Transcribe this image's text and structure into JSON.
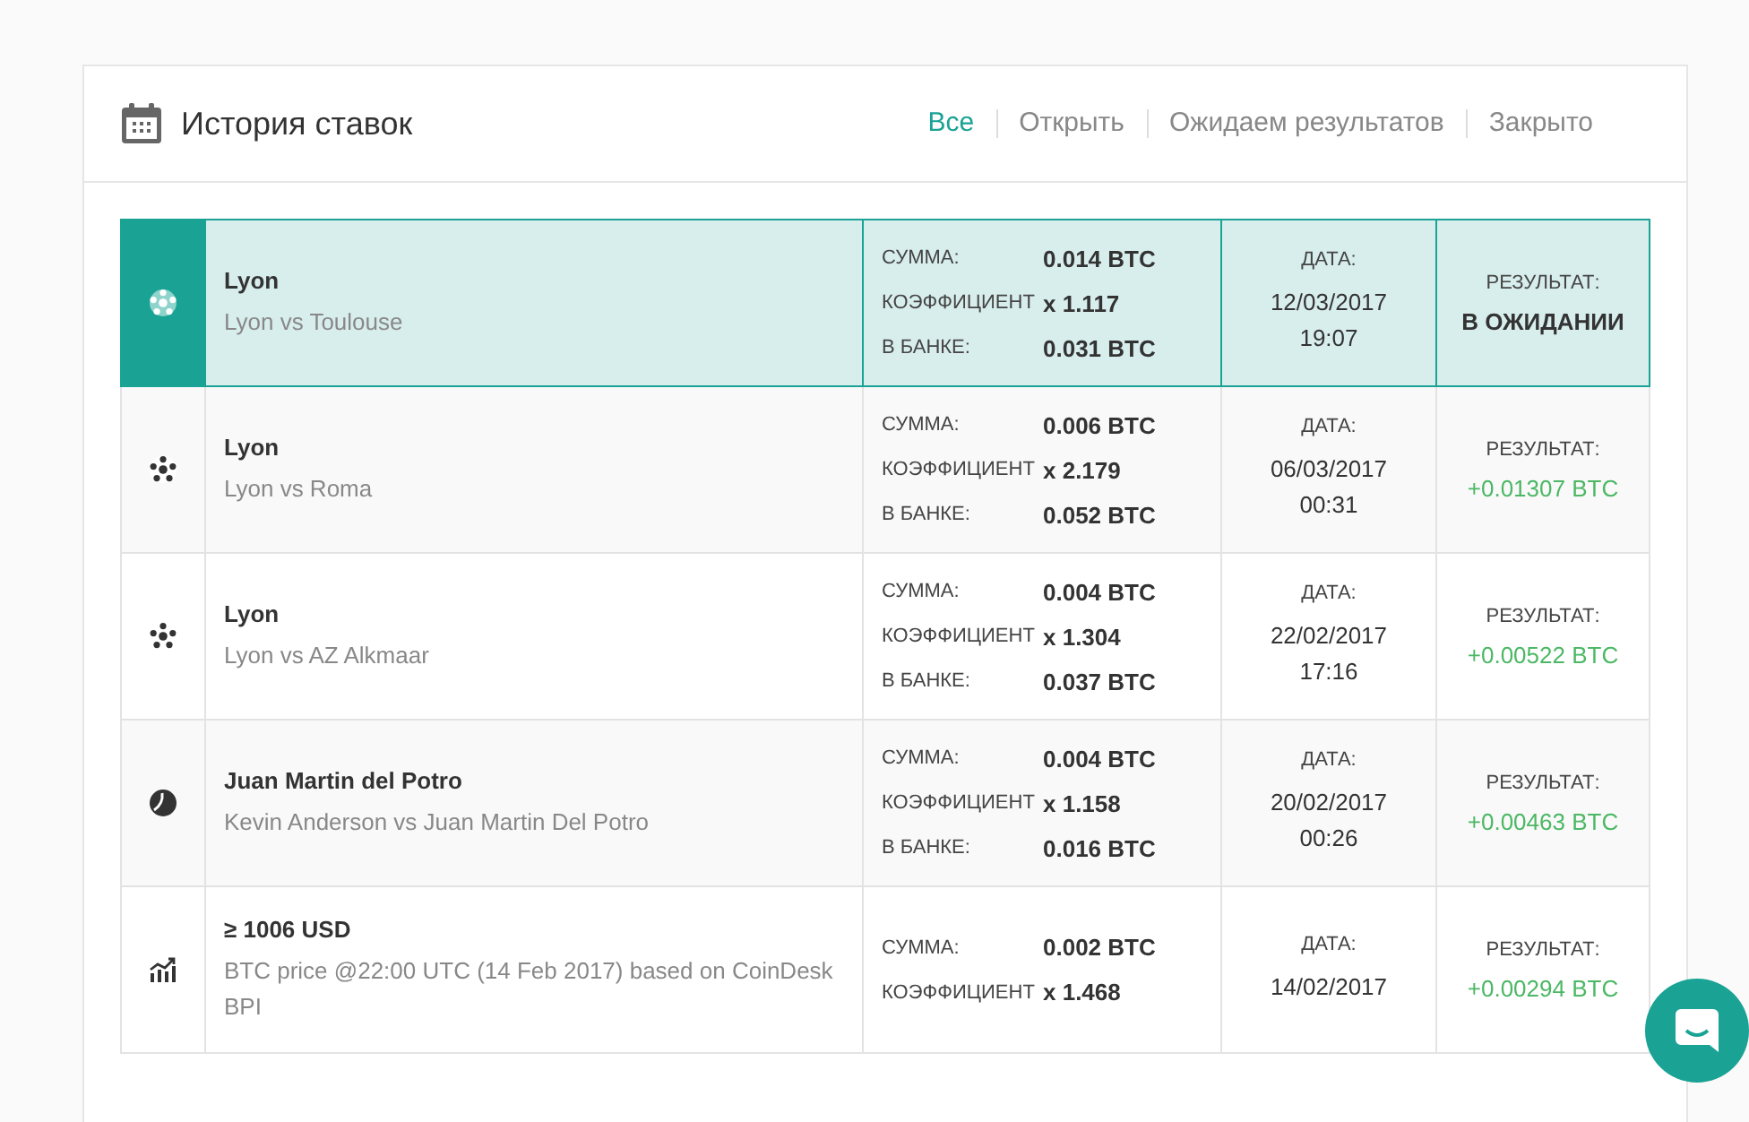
{
  "header": {
    "title": "История ставок"
  },
  "filters": [
    {
      "label": "Все",
      "selected": true
    },
    {
      "label": "Открыть",
      "selected": false
    },
    {
      "label": "Ожидаем результатов",
      "selected": false
    },
    {
      "label": "Закрыто",
      "selected": false
    }
  ],
  "rows": [
    {
      "selected": true,
      "kind": "soccer",
      "title": "Lyon",
      "subtitle": "Lyon vs Toulouse",
      "stake": [
        {
          "label": "СУММА:",
          "value": "0.014 BTC"
        },
        {
          "label": "КОЭФФИЦИЕНТ",
          "value": "x 1.117"
        },
        {
          "label": "В БАНКЕ:",
          "value": "0.031 BTC"
        }
      ],
      "date_label": "ДАТА:",
      "date": "12/03/2017",
      "time": "19:07",
      "result_label": "РЕЗУЛЬТАТ:",
      "result": {
        "kind": "pending",
        "text": "В ОЖИДАНИИ"
      }
    },
    {
      "selected": false,
      "kind": "soccer",
      "title": "Lyon",
      "subtitle": "Lyon vs Roma",
      "stake": [
        {
          "label": "СУММА:",
          "value": "0.006 BTC"
        },
        {
          "label": "КОЭФФИЦИЕНТ",
          "value": "x 2.179"
        },
        {
          "label": "В БАНКЕ:",
          "value": "0.052 BTC"
        }
      ],
      "date_label": "ДАТА:",
      "date": "06/03/2017",
      "time": "00:31",
      "result_label": "РЕЗУЛЬТАТ:",
      "result": {
        "kind": "win",
        "text": "+0.01307 BTC"
      }
    },
    {
      "selected": false,
      "kind": "soccer",
      "title": "Lyon",
      "subtitle": "Lyon vs AZ Alkmaar",
      "stake": [
        {
          "label": "СУММА:",
          "value": "0.004 BTC"
        },
        {
          "label": "КОЭФФИЦИЕНТ",
          "value": "x 1.304"
        },
        {
          "label": "В БАНКЕ:",
          "value": "0.037 BTC"
        }
      ],
      "date_label": "ДАТА:",
      "date": "22/02/2017",
      "time": "17:16",
      "result_label": "РЕЗУЛЬТАТ:",
      "result": {
        "kind": "win",
        "text": "+0.00522 BTC"
      }
    },
    {
      "selected": false,
      "kind": "tennis",
      "title": "Juan Martin del Potro",
      "subtitle": "Kevin Anderson vs Juan Martin Del Potro",
      "stake": [
        {
          "label": "СУММА:",
          "value": "0.004 BTC"
        },
        {
          "label": "КОЭФФИЦИЕНТ",
          "value": "x 1.158"
        },
        {
          "label": "В БАНКЕ:",
          "value": "0.016 BTC"
        }
      ],
      "date_label": "ДАТА:",
      "date": "20/02/2017",
      "time": "00:26",
      "result_label": "РЕЗУЛЬТАТ:",
      "result": {
        "kind": "win",
        "text": "+0.00463 BTC"
      }
    },
    {
      "selected": false,
      "kind": "chart",
      "title": "≥ 1006 USD",
      "subtitle": "BTC price @22:00 UTC (14 Feb 2017) based on CoinDesk BPI",
      "stake": [
        {
          "label": "СУММА:",
          "value": "0.002 BTC"
        },
        {
          "label": "КОЭФФИЦИЕНТ",
          "value": "x 1.468"
        }
      ],
      "date_label": "ДАТА:",
      "date": "14/02/2017",
      "result_label": "РЕЗУЛЬТАТ:",
      "result": {
        "kind": "win",
        "text": "+0.00294 BTC"
      }
    }
  ]
}
